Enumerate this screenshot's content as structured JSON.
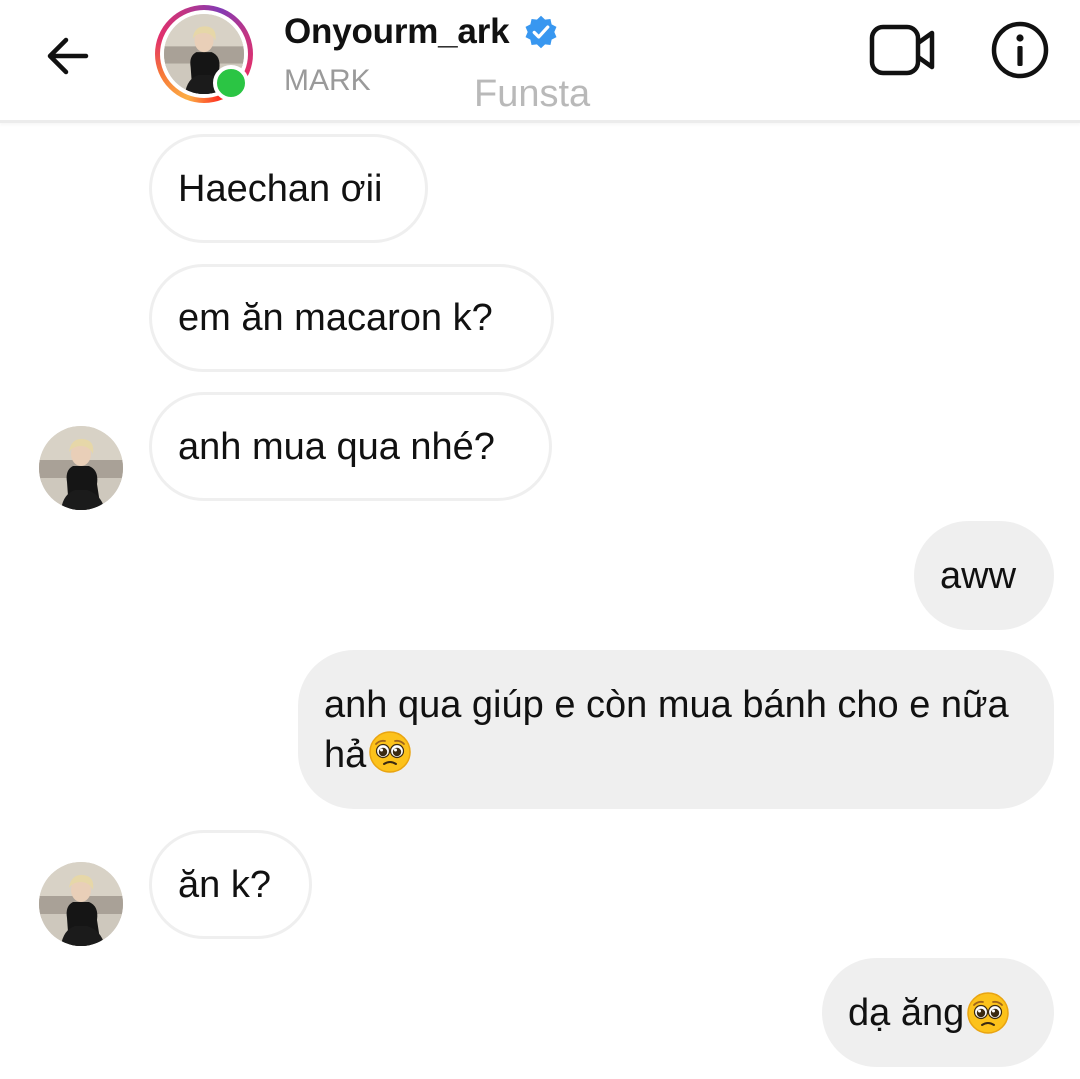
{
  "header": {
    "username": "Onyourm_ark",
    "subname": "MARK",
    "watermark": "Funsta",
    "icons": {
      "back": "arrow-left-icon",
      "verified": "verified-badge-icon",
      "video": "video-camera-icon",
      "info": "info-icon"
    },
    "colors": {
      "verified": "#3897f0",
      "online": "#2bc544"
    }
  },
  "messages": [
    {
      "direction": "incoming",
      "text": "Haechan ơii",
      "emoji": ""
    },
    {
      "direction": "incoming",
      "text": "em ăn macaron k?",
      "emoji": ""
    },
    {
      "direction": "incoming",
      "text": "anh mua qua nhé?",
      "emoji": ""
    },
    {
      "direction": "outgoing",
      "text": "aww",
      "emoji": ""
    },
    {
      "direction": "outgoing",
      "text": "anh qua giúp e còn mua bánh cho e nữa hả",
      "emoji": "pleading-face-emoji"
    },
    {
      "direction": "incoming",
      "text": "ăn k?",
      "emoji": ""
    },
    {
      "direction": "outgoing",
      "text": "dạ ăng",
      "emoji": "pleading-face-emoji"
    }
  ],
  "colors": {
    "incoming_bubble_bg": "#ffffff",
    "incoming_bubble_border": "#efefef",
    "outgoing_bubble_bg": "#efefef",
    "text": "#111111"
  }
}
